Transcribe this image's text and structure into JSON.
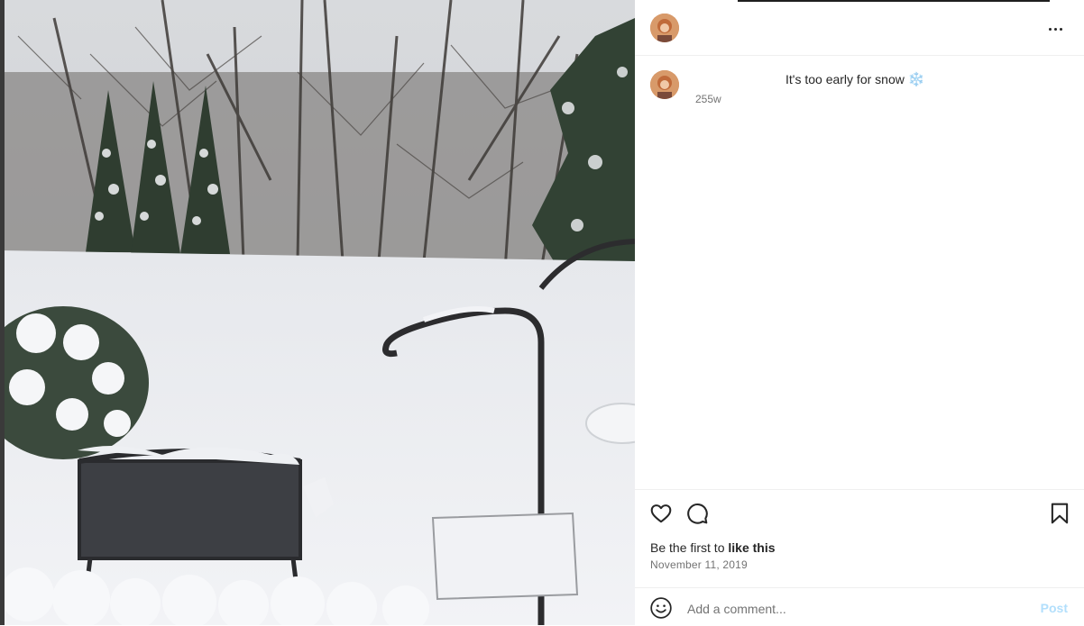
{
  "post": {
    "caption": "It's too early for snow",
    "caption_emoji": "❄️",
    "time_ago": "255w",
    "likes_prefix": "Be the first to ",
    "likes_bold": "like this",
    "date": "November 11, 2019"
  },
  "comment": {
    "placeholder": "Add a comment...",
    "post_label": "Post"
  },
  "icons": {
    "more": "more-options-icon",
    "like": "heart-icon",
    "comment": "comment-bubble-icon",
    "save": "bookmark-icon",
    "emoji": "emoji-smile-icon"
  },
  "colors": {
    "text_primary": "#262626",
    "text_secondary": "#737373",
    "post_disabled": "#b2dffc",
    "divider": "#efefef",
    "snow_emoji": "#9fd3f2"
  }
}
